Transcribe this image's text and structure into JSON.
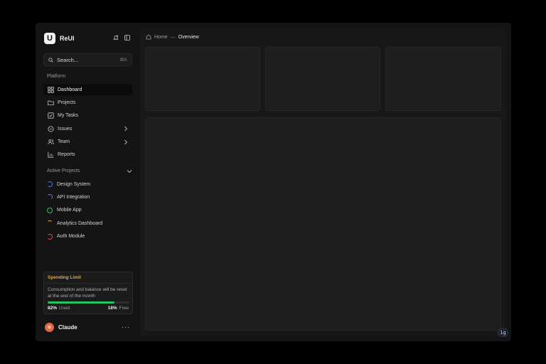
{
  "brand": {
    "logo_letter": "U",
    "name": "ReUI"
  },
  "search": {
    "placeholder": "Search...",
    "shortcut": "⌘K"
  },
  "platform": {
    "label": "Platform",
    "items": [
      {
        "label": "Dashboard",
        "icon": "dashboard-icon"
      },
      {
        "label": "Projects",
        "icon": "folder-icon"
      },
      {
        "label": "My Tasks",
        "icon": "checkbox-icon"
      },
      {
        "label": "Issues",
        "icon": "issue-circle-icon"
      },
      {
        "label": "Team",
        "icon": "users-icon"
      },
      {
        "label": "Reports",
        "icon": "chart-icon"
      }
    ]
  },
  "projects": {
    "label": "Active Projects",
    "items": [
      {
        "label": "Design System",
        "color": "#3b82f6"
      },
      {
        "label": "API Integration",
        "color": "#8b5cf6"
      },
      {
        "label": "Mobile App",
        "color": "#22c55e"
      },
      {
        "label": "Analytics Dashboard",
        "color": "#f59e0b"
      },
      {
        "label": "Auth Module",
        "color": "#ef4444"
      }
    ]
  },
  "spending": {
    "title": "Spending Limit",
    "text": "Consumption and balance will be reset at the end of the month",
    "used_pct": 82,
    "used_value": "82%",
    "used_label": "Used",
    "free_value": "18%",
    "free_label": "Free",
    "title_color": "#e3a83b",
    "bar_color": "#22c55e"
  },
  "user": {
    "name": "Claude",
    "avatar": "✳",
    "menu": "···"
  },
  "breadcrumb": {
    "home": "Home",
    "separator": "—",
    "current": "Overview"
  },
  "badge": "1g"
}
